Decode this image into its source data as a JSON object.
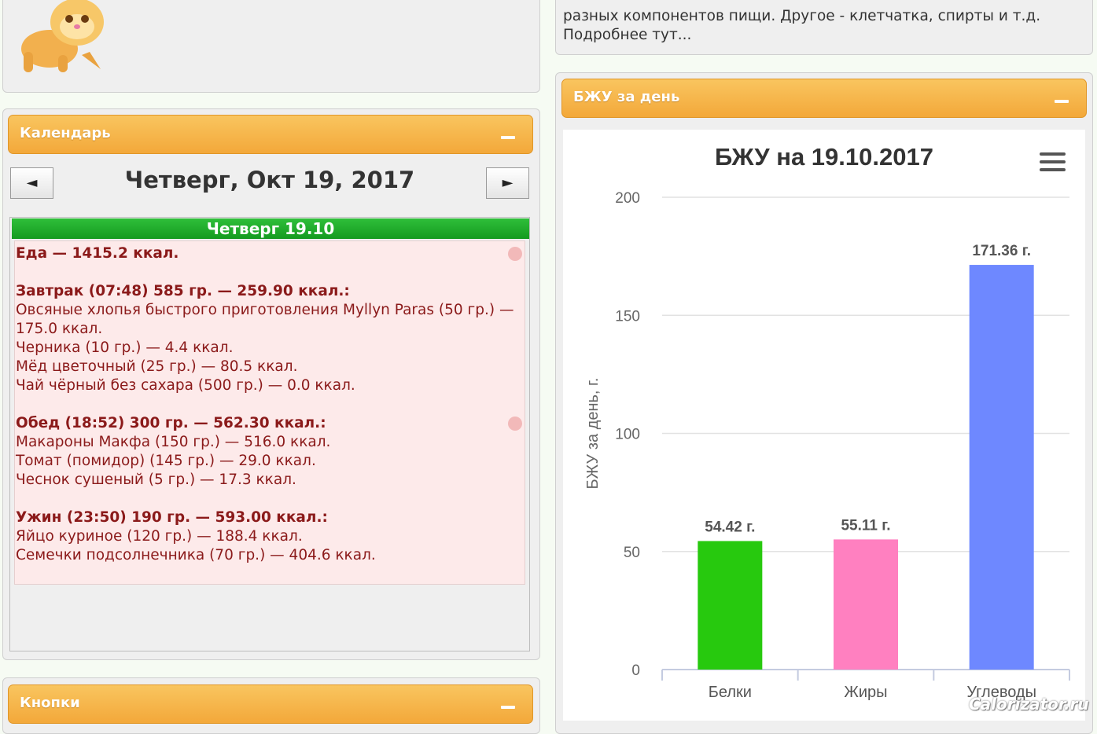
{
  "top_note": {
    "line1": "разных компонентов пищи. Другое - клетчатка, спирты и т.д.",
    "line2": "Подробнее тут..."
  },
  "calendar": {
    "header": "Календарь",
    "prev_label": "◄",
    "next_label": "►",
    "date_title": "Четверг, Окт 19, 2017",
    "day_label": "Четверг 19.10",
    "lines": [
      {
        "text": "Еда — 1415.2 ккал.",
        "bold": true
      },
      {
        "text": "Завтрак (07:48) 585 гр. — 259.90 ккал.:",
        "bold": true
      },
      {
        "text": " Овсяные хлопья быстрого приготовления Myllyn Paras (50 гр.) —",
        "bold": false
      },
      {
        "text": "175.0 ккал.",
        "bold": false
      },
      {
        "text": " Черника (10 гр.) — 4.4 ккал.",
        "bold": false
      },
      {
        "text": " Мёд цветочный (25 гр.) — 80.5 ккал.",
        "bold": false
      },
      {
        "text": " Чай чёрный без сахара (500 гр.) — 0.0 ккал.",
        "bold": false
      },
      {
        "text": "Обед (18:52) 300 гр. — 562.30 ккал.:",
        "bold": true
      },
      {
        "text": " Макароны Макфа (150 гр.) — 516.0 ккал.",
        "bold": false
      },
      {
        "text": " Томат (помидор) (145 гр.) — 29.0 ккал.",
        "bold": false
      },
      {
        "text": " Чеснок сушеный (5 гр.) — 17.3 ккал.",
        "bold": false
      },
      {
        "text": "Ужин (23:50) 190 гр. — 593.00 ккал.:",
        "bold": true
      },
      {
        "text": " Яйцо куриное (120 гр.) — 188.4 ккал.",
        "bold": false
      },
      {
        "text": " Семечки подсолнечника (70 гр.) — 404.6 ккал.",
        "bold": false
      }
    ]
  },
  "buttons_panel": {
    "header": "Кнопки"
  },
  "bju_panel": {
    "header": "БЖУ за день"
  },
  "chart_data": {
    "type": "bar",
    "title": "БЖУ на 19.10.2017",
    "ylabel": "БЖУ за день, г.",
    "xlabel": "",
    "categories": [
      "Белки",
      "Жиры",
      "Углеводы"
    ],
    "values": [
      54.42,
      55.11,
      171.36
    ],
    "data_labels": [
      "54.42 г.",
      "55.11 г.",
      "171.36 г."
    ],
    "colors": [
      "#27c90e",
      "#ff80c0",
      "#6e88ff"
    ],
    "ylim": [
      0,
      200
    ],
    "yticks": [
      0,
      50,
      100,
      150,
      200
    ],
    "grid": true,
    "legend": "none"
  },
  "watermark": "Calorizator.ru"
}
